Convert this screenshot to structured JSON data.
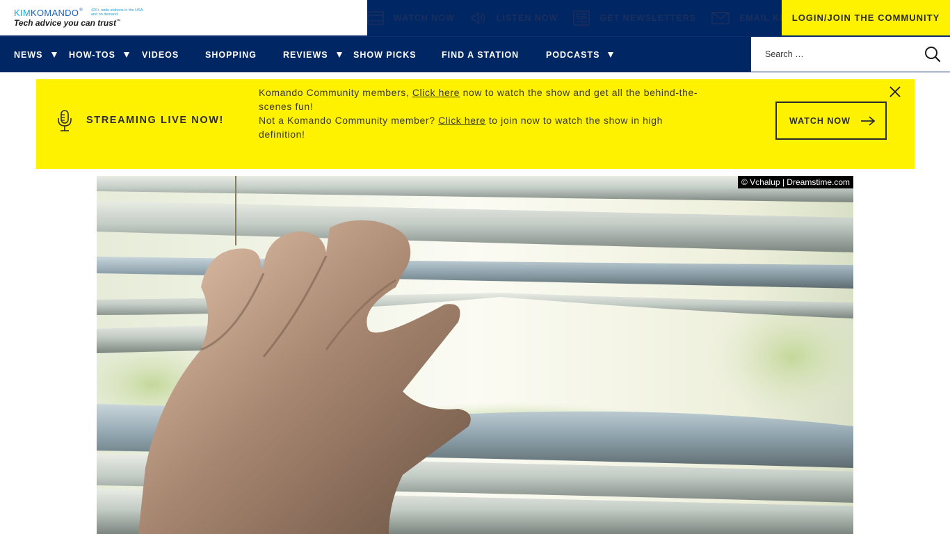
{
  "logo": {
    "brand_part1": "KIM",
    "brand_part2": "KOMANDO",
    "registered": "®",
    "tagline_small": "420+ radio stations in the USA and on demand",
    "slogan": "Tech advice you can trust",
    "slogan_tm": "™"
  },
  "utility_links": [
    {
      "label": "WATCH NOW",
      "icon": "video-player-icon"
    },
    {
      "label": "LISTEN NOW",
      "icon": "speaker-icon"
    },
    {
      "label": "GET NEWSLETTERS",
      "icon": "newsletter-icon"
    },
    {
      "label": "EMAIL KIM",
      "icon": "envelope-icon"
    }
  ],
  "login_button": "LOGIN/JOIN THE COMMUNITY",
  "nav": {
    "items": [
      {
        "label": "NEWS",
        "dropdown": true
      },
      {
        "label": "HOW-TOS",
        "dropdown": true
      },
      {
        "label": "VIDEOS",
        "dropdown": false
      },
      {
        "label": "SHOPPING",
        "dropdown": false
      },
      {
        "label": "REVIEWS",
        "dropdown": true
      },
      {
        "label": "SHOW PICKS",
        "dropdown": false
      },
      {
        "label": "FIND A STATION",
        "dropdown": false
      },
      {
        "label": "PODCASTS",
        "dropdown": true
      }
    ]
  },
  "search": {
    "placeholder": "Search …",
    "value": ""
  },
  "banner": {
    "title": "STREAMING LIVE NOW!",
    "line1_before": "Komando Community members, ",
    "line1_link": "Click here",
    "line1_after": " now to watch the show and get all the behind-the-scenes fun!",
    "line2_before": "Not a Komando Community member? ",
    "line2_link": "Click here",
    "line2_after": " to join now to watch the show in high definition!",
    "watch_button": "WATCH NOW"
  },
  "hero": {
    "alt": "Hand parting window blinds",
    "credit": "© Vchalup | Dreamstime.com"
  },
  "colors": {
    "navy": "#002664",
    "yellow": "#fff200",
    "logo_blue": "#1ea0dc",
    "text_dark": "#2b2b2b"
  }
}
